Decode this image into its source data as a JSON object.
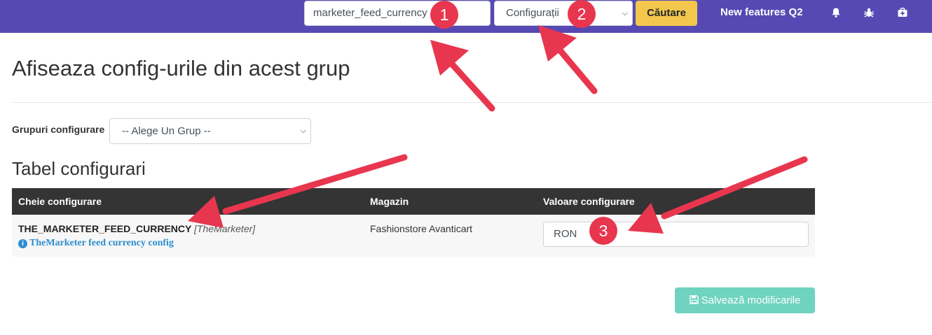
{
  "topbar": {
    "search_value": "marketer_feed_currency",
    "scope_value": "Configurații",
    "search_button": "Căutare",
    "nav_link": "New features Q2",
    "icons": [
      "bell-icon",
      "bug-icon",
      "medkit-icon"
    ]
  },
  "page": {
    "title": "Afiseaza config-urile din acest grup",
    "group_label": "Grupuri configurare",
    "group_select_value": "-- Alege Un Grup --",
    "section_title": "Tabel configurari"
  },
  "table": {
    "headers": [
      "Cheie configurare",
      "Magazin",
      "Valoare configurare"
    ],
    "rows": [
      {
        "key": "THE_MARKETER_FEED_CURRENCY",
        "scope": "[TheMarketer]",
        "help": "TheMarketer feed currency config",
        "store": "Fashionstore Avanticart",
        "value": "RON"
      }
    ]
  },
  "save_button": "Salvează modificarile",
  "markers": [
    "1",
    "2",
    "3"
  ],
  "colors": {
    "topbar": "#5749b3",
    "search_button": "#f3c74c",
    "table_header": "#343434",
    "save_button": "#6fd3bf",
    "annotation": "#e8364f",
    "link": "#2b8ecf"
  }
}
